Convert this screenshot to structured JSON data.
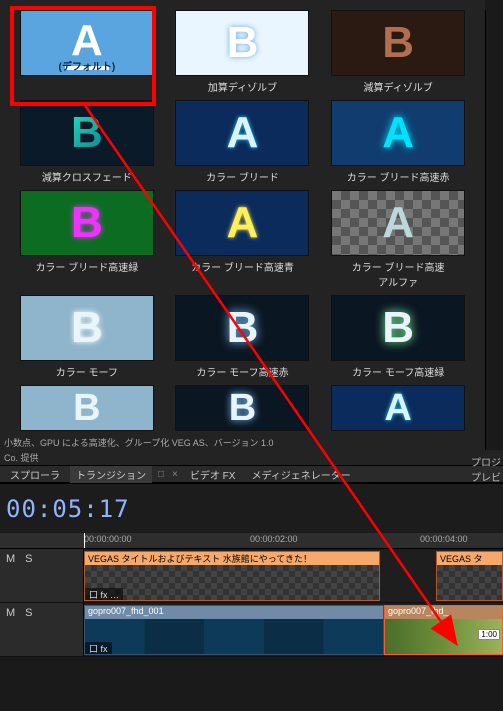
{
  "transitions": {
    "default_inside_label": "(デフォルト)",
    "items": [
      {
        "label": "",
        "glyph": "A"
      },
      {
        "label": "加算ディゾルブ",
        "glyph": "B"
      },
      {
        "label": "減算ディゾルブ",
        "glyph": "B"
      },
      {
        "label": "減算クロスフェード",
        "glyph": "B"
      },
      {
        "label": "カラー ブリード",
        "glyph": "A"
      },
      {
        "label": "カラー ブリード高速赤",
        "glyph": "A"
      },
      {
        "label": "カラー ブリード高速緑",
        "glyph": "B"
      },
      {
        "label": "カラー ブリード高速青",
        "glyph": "A"
      },
      {
        "label": "カラー ブリード高速\nアルファ",
        "glyph": "A"
      },
      {
        "label": "カラー モーフ",
        "glyph": "B"
      },
      {
        "label": "カラー モーフ高速赤",
        "glyph": "B"
      },
      {
        "label": "カラー モーフ高速緑",
        "glyph": "B"
      },
      {
        "label": "",
        "glyph": "B"
      },
      {
        "label": "",
        "glyph": "B"
      },
      {
        "label": "",
        "glyph": "A"
      }
    ]
  },
  "footer": {
    "line1": "小数点、GPU による高速化、グループ化  VEG AS、バージョン 1.0",
    "line2": "Co. 提供"
  },
  "right_panel": {
    "label1": "プロジ",
    "label2": "プレビ"
  },
  "tabs": {
    "explorer": "スプローラ",
    "transition": "トランジション",
    "video_fx": "ビデオ FX",
    "media_gen": "メディジェネレーター",
    "pin": "□",
    "close": "×"
  },
  "timecode": "00:05:17",
  "ruler": {
    "t0": "00:00:00:00",
    "t1": "00:00:02:00",
    "t2": "00:00:04:00"
  },
  "track_buttons": {
    "mute": "M",
    "solo": "S"
  },
  "clips": {
    "title1_main": "VEGAS タイトルおよびテキスト 水族館にやってきた！",
    "title1_right": "VEGAS タ",
    "video1_name": "gopro007_fhd_001",
    "video2_name": "gopro007_fhd_",
    "fx_footer": "口  fx  …",
    "fx_footer2": "口 fx",
    "duration_badge": "1:00"
  }
}
